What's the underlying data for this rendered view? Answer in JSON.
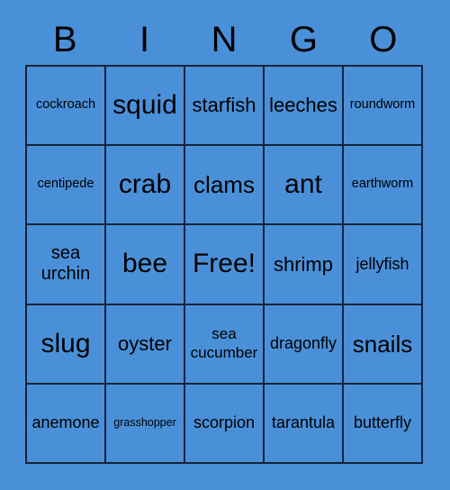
{
  "card": {
    "background_color": "#4a90d9",
    "border_color": "#16233a",
    "text_color": "#000000"
  },
  "header": {
    "letters": [
      "B",
      "I",
      "N",
      "G",
      "O"
    ]
  },
  "grid": {
    "rows": 5,
    "columns": 5,
    "free_space": "Free!",
    "cells": [
      [
        {
          "text": "cockroach",
          "size": "xs"
        },
        {
          "text": "squid",
          "size": "xl"
        },
        {
          "text": "starfish",
          "size": "md"
        },
        {
          "text": "leeches",
          "size": "md"
        },
        {
          "text": "roundworm",
          "size": "xs"
        }
      ],
      [
        {
          "text": "centipede",
          "size": "xs"
        },
        {
          "text": "crab",
          "size": "xl"
        },
        {
          "text": "clams",
          "size": "lg"
        },
        {
          "text": "ant",
          "size": "xl"
        },
        {
          "text": "earthworm",
          "size": "xs"
        }
      ],
      [
        {
          "text": "sea\nurchin",
          "size": "wrap2"
        },
        {
          "text": "bee",
          "size": "xl"
        },
        {
          "text": "Free!",
          "size": "xl"
        },
        {
          "text": "shrimp",
          "size": "md"
        },
        {
          "text": "jellyfish",
          "size": "sm"
        }
      ],
      [
        {
          "text": "slug",
          "size": "xl"
        },
        {
          "text": "oyster",
          "size": "md"
        },
        {
          "text": "sea\ncucumber",
          "size": "wrap2s"
        },
        {
          "text": "dragonfly",
          "size": "sm"
        },
        {
          "text": "snails",
          "size": "lg"
        }
      ],
      [
        {
          "text": "anemone",
          "size": "sm"
        },
        {
          "text": "grasshopper",
          "size": "xxs"
        },
        {
          "text": "scorpion",
          "size": "sm"
        },
        {
          "text": "tarantula",
          "size": "sm"
        },
        {
          "text": "butterfly",
          "size": "sm"
        }
      ]
    ]
  }
}
